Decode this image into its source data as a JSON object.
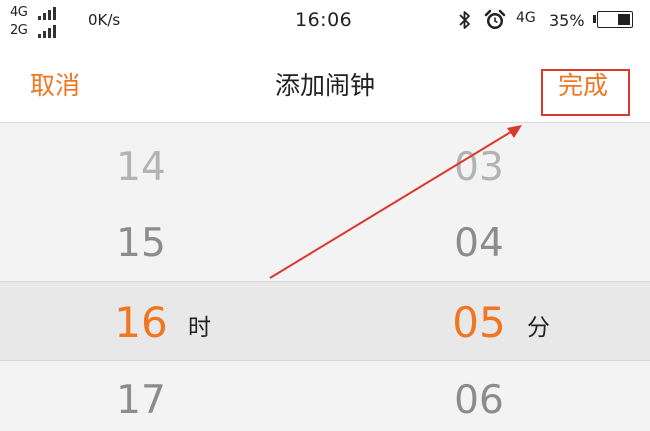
{
  "status_bar": {
    "network_top": "4G",
    "network_bottom": "2G",
    "speed": "0K/s",
    "time": "16:06",
    "network_right": "4G",
    "battery": "35%",
    "battery_level": 0.35,
    "icons": [
      "signal-icon",
      "bluetooth-icon",
      "alarm-clock-icon",
      "battery-icon"
    ]
  },
  "header": {
    "cancel_label": "取消",
    "title": "添加闹钟",
    "done_label": "完成"
  },
  "picker": {
    "hour": {
      "above2": "14",
      "above1": "15",
      "selected": "16",
      "below1": "17",
      "unit": "时"
    },
    "minute": {
      "above2": "03",
      "above1": "04",
      "selected": "05",
      "below1": "06",
      "unit": "分"
    }
  },
  "colors": {
    "accent": "#f07621",
    "annotation": "#d93a2f"
  }
}
